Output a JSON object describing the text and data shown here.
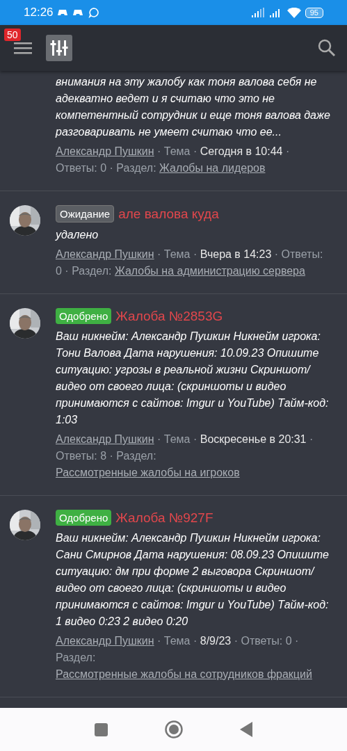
{
  "status_bar": {
    "time": "12:26",
    "battery": "95"
  },
  "header": {
    "notification_count": "50"
  },
  "threads": [
    {
      "excerpt": "внимания на эту жалобу как тоня валова себя не адекватно ведет и я считаю что это не компетентный сотрудник и еще тоня валова даже разговаривать не умеет считаю что ее...",
      "author": "Александр Пушкин",
      "type": "Тема",
      "date": "Сегодня в 10:44",
      "replies": "Ответы: 0",
      "section_label": "Раздел:",
      "section": "Жалобы на лидеров",
      "separator": "·"
    },
    {
      "status": {
        "label": "Ожидание",
        "kind": "pending"
      },
      "title": "але валова куда",
      "excerpt": "удалено",
      "author": "Александр Пушкин",
      "type": "Тема",
      "date": "Вчера в 14:23",
      "replies": "Ответы: 0",
      "section_label": "Раздел:",
      "section": "Жалобы на администрацию сервера",
      "separator": "·"
    },
    {
      "status": {
        "label": "Одобрено",
        "kind": "approved"
      },
      "title": "Жалоба №2853G",
      "excerpt": "Ваш никнейм: Александр Пушкин Никнейм игрока: Тони Валова Дата нарушения: 10.09.23 Опишите ситуацию: угрозы в реальной жизни Скриншот/видео от своего лица: (скриншоты и видео принимаются с сайтов: Imgur и YouTube) Тайм-код: 1:03",
      "author": "Александр Пушкин",
      "type": "Тема",
      "date": "Воскресенье в 20:31",
      "replies": "Ответы: 8",
      "section_label": "Раздел:",
      "section": "Рассмотренные жалобы на игроков",
      "separator": "·"
    },
    {
      "status": {
        "label": "Одобрено",
        "kind": "approved"
      },
      "title": "Жалоба №927F",
      "excerpt": "Ваш никнейм: Александр Пушкин Никнейм игрока: Сани Смирнов Дата нарушения: 08.09.23 Опишите ситуацию: дм при форме 2 выговора Скриншот/видео от своего лица: (скриншоты и видео принимаются с сайтов: Imgur и YouTube) Тайм-код: 1 видео 0:23 2 видео 0:20",
      "author": "Александр Пушкин",
      "type": "Тема",
      "date": "8/9/23",
      "replies": "Ответы: 0",
      "section_label": "Раздел:",
      "section": "Рассмотренные жалобы на сотрудников фракций",
      "separator": "·"
    }
  ]
}
